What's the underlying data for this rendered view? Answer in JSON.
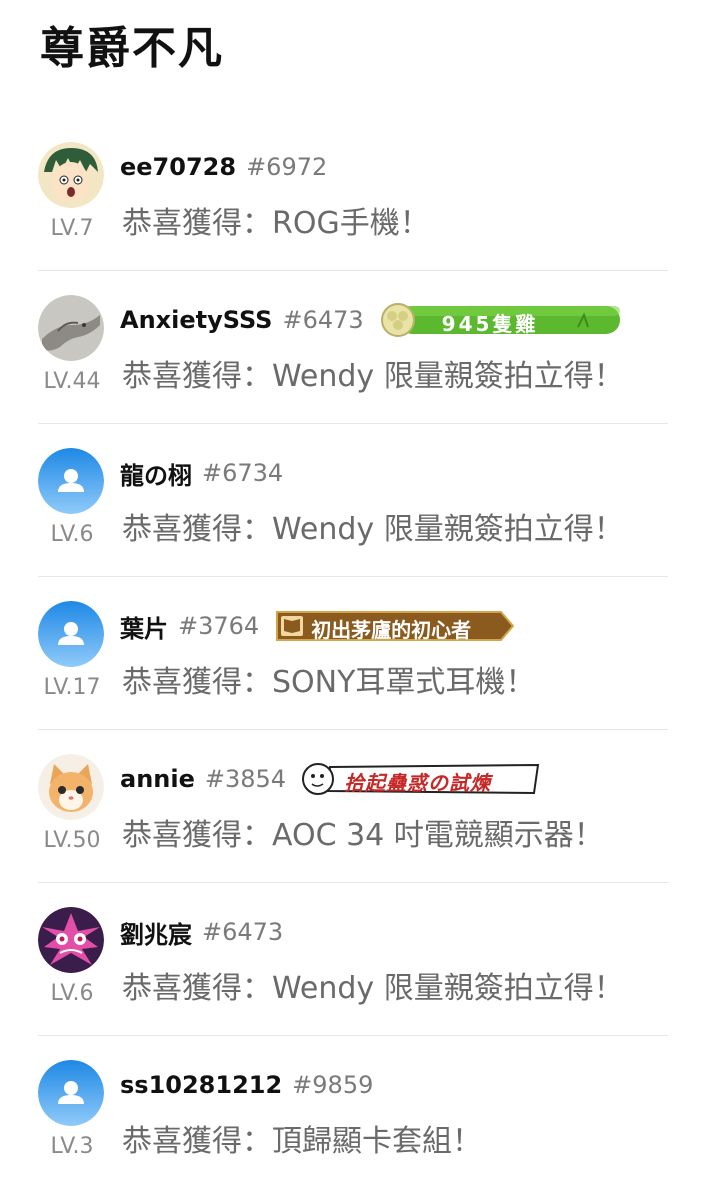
{
  "page": {
    "title": "尊爵不凡"
  },
  "winners": [
    {
      "avatar": "avatar-anime-green-hair",
      "username": "ee70728",
      "id": "#6972",
      "level": "LV.7",
      "prize": "恭喜獲得：ROG手機！",
      "badge": null
    },
    {
      "avatar": "avatar-stone-dragon",
      "username": "AnxietySSS",
      "id": "#6473",
      "level": "LV.44",
      "prize": "恭喜獲得：Wendy 限量親簽拍立得！",
      "badge": {
        "type": "green",
        "text": "945隻雞"
      }
    },
    {
      "avatar": "default-user-icon",
      "username": "龍の栩",
      "id": "#6734",
      "level": "LV.6",
      "prize": "恭喜獲得：Wendy 限量親簽拍立得！",
      "badge": null
    },
    {
      "avatar": "default-user-icon",
      "username": "葉片",
      "id": "#3764",
      "level": "LV.17",
      "prize": "恭喜獲得：SONY耳罩式耳機！",
      "badge": {
        "type": "gold",
        "text": "初出茅廬的初心者"
      }
    },
    {
      "avatar": "avatar-kitten",
      "username": "annie",
      "id": "#3854",
      "level": "LV.50",
      "prize": "恭喜獲得：AOC 34 吋電競顯示器！",
      "badge": {
        "type": "sketch",
        "text": "拾起蠱惑の試煉"
      }
    },
    {
      "avatar": "avatar-anime-pink",
      "username": "劉兆宸",
      "id": "#6473",
      "level": "LV.6",
      "prize": "恭喜獲得：Wendy 限量親簽拍立得！",
      "badge": null
    },
    {
      "avatar": "default-user-icon",
      "username": "ss10281212",
      "id": "#9859",
      "level": "LV.3",
      "prize": "恭喜獲得：頂歸顯卡套組！",
      "badge": null
    }
  ],
  "colors": {
    "default_avatar_top": "#1e88e5",
    "default_avatar_bottom": "#90caf9",
    "badge_green": "#5cb82e",
    "badge_gold": "#8a5a1f"
  }
}
